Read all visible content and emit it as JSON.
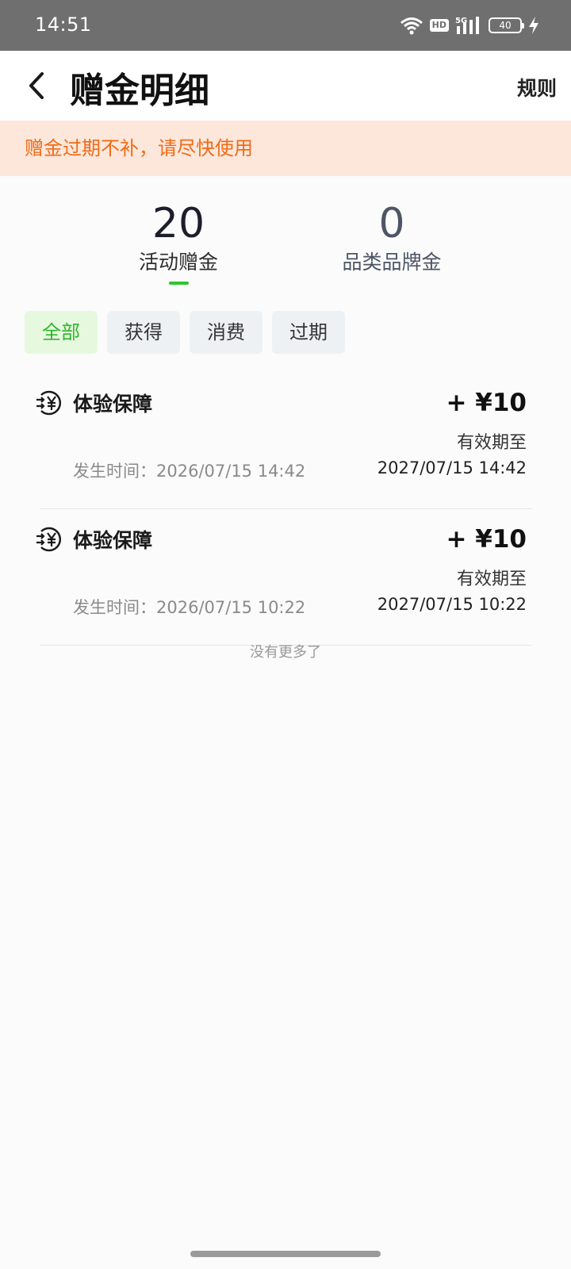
{
  "status_bar": {
    "time": "14:51",
    "hd": "HD",
    "network": "5G",
    "battery": "40"
  },
  "header": {
    "title": "赠金明细",
    "rules": "规则"
  },
  "notice": {
    "text": "赠金过期不补，请尽快使用",
    "color": "#ef6b1a",
    "background": "#fde7da"
  },
  "top_tabs": [
    {
      "amount": "20",
      "label": "活动赠金",
      "selected": true
    },
    {
      "amount": "0",
      "label": "品类品牌金",
      "selected": false
    }
  ],
  "filters": [
    {
      "label": "全部",
      "selected": true
    },
    {
      "label": "获得",
      "selected": false
    },
    {
      "label": "消费",
      "selected": false
    },
    {
      "label": "过期",
      "selected": false
    }
  ],
  "records": [
    {
      "icon": "yen-transfer-icon",
      "title": "体验保障",
      "amount": "+ ¥10",
      "validity_label": "有效期至",
      "time_text": "发生时间：2026/07/15 14:42",
      "expiry": "2027/07/15 14:42"
    },
    {
      "icon": "yen-transfer-icon",
      "title": "体验保障",
      "amount": "+ ¥10",
      "validity_label": "有效期至",
      "time_text": "发生时间：2026/07/15 10:22",
      "expiry": "2027/07/15 10:22"
    }
  ],
  "footer": {
    "no_more": "没有更多了"
  },
  "colors": {
    "accent_green": "#2ec52e",
    "status_bar": "#6f6f6f"
  }
}
